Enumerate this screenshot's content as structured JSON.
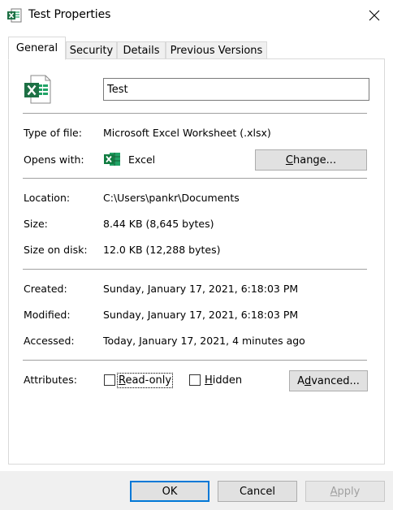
{
  "window": {
    "title": "Test Properties",
    "close_icon": "close-icon"
  },
  "tabs": [
    {
      "label": "General",
      "active": true
    },
    {
      "label": "Security",
      "active": false
    },
    {
      "label": "Details",
      "active": false
    },
    {
      "label": "Previous Versions",
      "active": false
    }
  ],
  "file": {
    "name": "Test",
    "icon": "excel-file-icon"
  },
  "type": {
    "label": "Type of file:",
    "value": "Microsoft Excel Worksheet (.xlsx)"
  },
  "opens": {
    "label": "Opens with:",
    "app": "Excel",
    "app_icon": "excel-icon",
    "change_prefix": "C",
    "change_rest": "hange..."
  },
  "location": {
    "label": "Location:",
    "value": "C:\\Users\\pankr\\Documents"
  },
  "size": {
    "label": "Size:",
    "value": "8.44 KB (8,645 bytes)"
  },
  "size_on_disk": {
    "label": "Size on disk:",
    "value": "12.0 KB (12,288 bytes)"
  },
  "created": {
    "label": "Created:",
    "value": "Sunday, January 17, 2021, 6:18:03 PM"
  },
  "modified": {
    "label": "Modified:",
    "value": "Sunday, January 17, 2021, 6:18:03 PM"
  },
  "accessed": {
    "label": "Accessed:",
    "value": "Today, January 17, 2021, 4 minutes ago"
  },
  "attributes": {
    "label": "Attributes:",
    "readonly_prefix": "R",
    "readonly_rest": "ead-only",
    "readonly_checked": false,
    "hidden_prefix": "H",
    "hidden_rest": "idden",
    "hidden_checked": false,
    "advanced_prefix": "A",
    "advanced_rest": "d",
    "advanced_tail": "vanced..."
  },
  "buttons": {
    "ok": "OK",
    "cancel": "Cancel",
    "apply_prefix": "A",
    "apply_rest": "pply"
  },
  "colors": {
    "excel_green": "#1d7044",
    "accent_blue": "#0078d7"
  }
}
